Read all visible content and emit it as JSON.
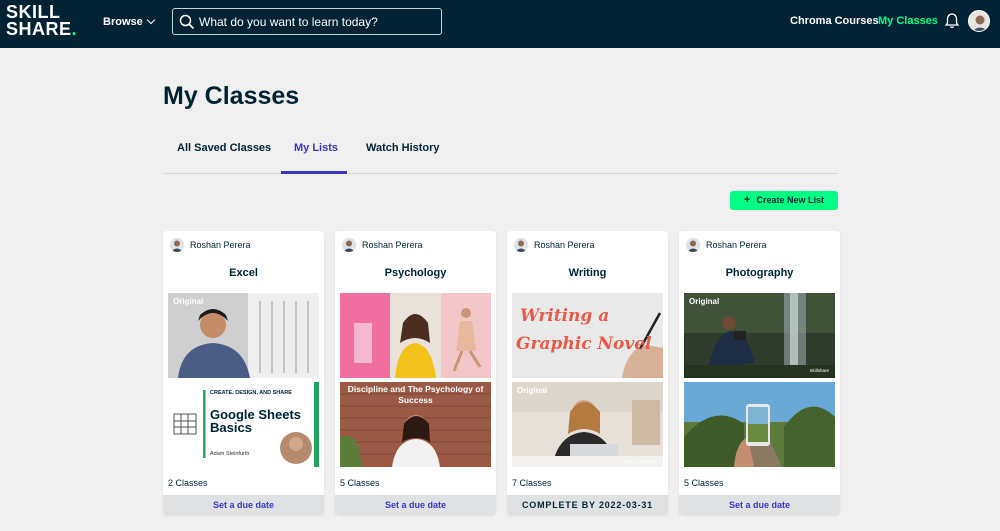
{
  "header": {
    "logo_line1": "SKILL",
    "logo_line2": "SHARE",
    "logo_dot": ".",
    "browse_label": "Browse",
    "search_placeholder": "What do you want to learn today?",
    "chroma_label": "Chroma Courses",
    "my_classes_label": "My Classes"
  },
  "page": {
    "title": "My Classes",
    "tabs": [
      {
        "label": "All Saved Classes"
      },
      {
        "label": "My Lists"
      },
      {
        "label": "Watch History"
      }
    ],
    "create_button": "Create New List"
  },
  "cards": [
    {
      "owner": "Roshan Perera",
      "name": "Excel",
      "thumb1_badge": "Original",
      "thumb2_lines": [
        "CREATE, DESIGN, AND SHARE",
        "Google Sheets",
        "Basics",
        "Adam Steinfurth"
      ],
      "count": "2 Classes",
      "footer": "Set a due date"
    },
    {
      "owner": "Roshan Perera",
      "name": "Psychology",
      "thumb2_title": "Discipline and The Psychology of Success",
      "count": "5 Classes",
      "footer": "Set a due date"
    },
    {
      "owner": "Roshan Perera",
      "name": "Writing",
      "thumb1_title_1": "Writing a",
      "thumb1_title_2": "Graphic Novel",
      "thumb2_badge": "Original",
      "thumb2_watermark": "SKILLSHARE",
      "count": "7 Classes",
      "footer": "COMPLETE BY 2022-03-31"
    },
    {
      "owner": "Roshan Perera",
      "name": "Photography",
      "thumb1_badge": "Original",
      "thumb1_watermark": "Skillshare",
      "count": "5 Classes",
      "footer": "Set a due date"
    }
  ],
  "colors": {
    "header_bg": "#002333",
    "accent_green": "#00ff84",
    "accent_purple": "#3a35c6"
  }
}
